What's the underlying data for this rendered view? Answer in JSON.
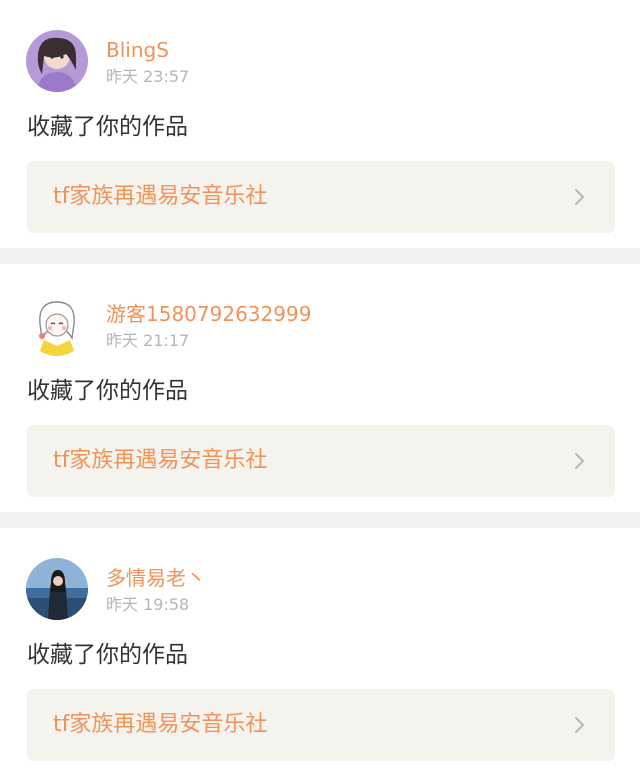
{
  "notifications": [
    {
      "user": "BlingS",
      "time": "昨天 23:57",
      "action": "收藏了你的作品",
      "work": "tf家族再遇易安音乐社",
      "avatar_icon": "girl-photo-avatar"
    },
    {
      "user": "游客1580792632999",
      "time": "昨天 21:17",
      "action": "收藏了你的作品",
      "work": "tf家族再遇易安音乐社",
      "avatar_icon": "cartoon-girl-avatar"
    },
    {
      "user": "多情易老丶",
      "time": "昨天 19:58",
      "action": "收藏了你的作品",
      "work": "tf家族再遇易安音乐社",
      "avatar_icon": "seaside-photo-avatar"
    }
  ],
  "colors": {
    "accent": "#f0935a",
    "time_text": "#b5b5b5",
    "body_text": "#333333",
    "work_bg": "#f4f3ee",
    "separator": "#f2f2f2"
  }
}
